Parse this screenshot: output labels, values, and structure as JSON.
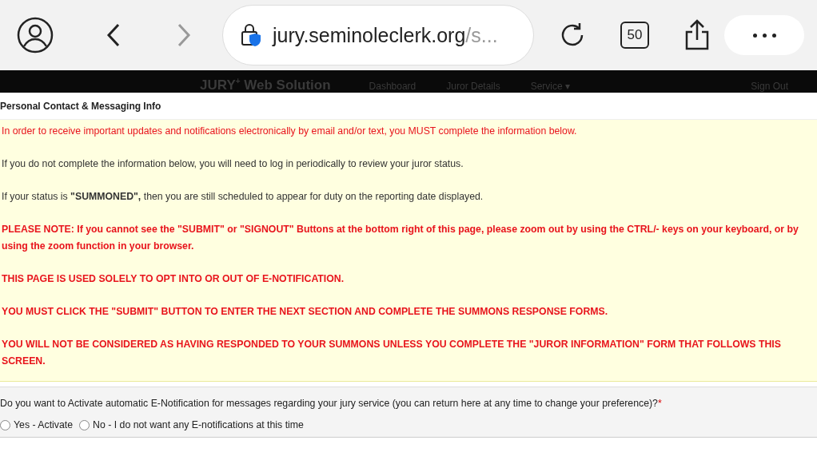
{
  "browser": {
    "url_host": "jury.seminoleclerk.org",
    "url_rest": "/s...",
    "tab_count": "50"
  },
  "site_nav": {
    "brand": "JURY",
    "brand_sup": "+",
    "brand_rest": " Web Solution",
    "links": [
      "Dashboard",
      "Juror Details",
      "Service ▾"
    ],
    "sign_out": "Sign Out"
  },
  "section_title": "Personal Contact & Messaging Info",
  "notices": [
    {
      "kind": "red",
      "text": "In order to receive important updates and notifications electronically by email and/or text, you MUST complete the information below."
    },
    {
      "kind": "plain",
      "text": "If you do not complete the information below, you will need to log in periodically to review your juror status."
    },
    {
      "kind": "plain",
      "text": "If your status is **\"SUMMONED\",** then you are still scheduled to appear for duty on the reporting date displayed."
    },
    {
      "kind": "alert",
      "text": "PLEASE NOTE:  If you cannot see the \"SUBMIT\" or \"SIGNOUT\" Buttons at the bottom right of this page, please zoom out by using the CTRL/- keys on your keyboard, or by using the zoom function in your browser."
    },
    {
      "kind": "alert",
      "text": "THIS PAGE IS USED SOLELY TO OPT INTO OR OUT OF E-NOTIFICATION."
    },
    {
      "kind": "alert",
      "text": "YOU MUST CLICK THE \"SUBMIT\" BUTTON TO ENTER THE NEXT SECTION AND COMPLETE THE SUMMONS RESPONSE FORMS."
    },
    {
      "kind": "alert",
      "text": "YOU WILL NOT BE CONSIDERED AS HAVING RESPONDED TO YOUR SUMMONS UNLESS YOU COMPLETE THE \"JUROR INFORMATION\" FORM THAT FOLLOWS THIS SCREEN."
    }
  ],
  "question": {
    "text": "Do you want to Activate automatic E-Notification for messages regarding your jury service (you can return here at any time to change your preference)?",
    "required_mark": "*",
    "options": [
      {
        "label": "Yes - Activate",
        "selected": false
      },
      {
        "label": "No - I do not want any E-notifications at this time",
        "selected": false
      }
    ]
  }
}
